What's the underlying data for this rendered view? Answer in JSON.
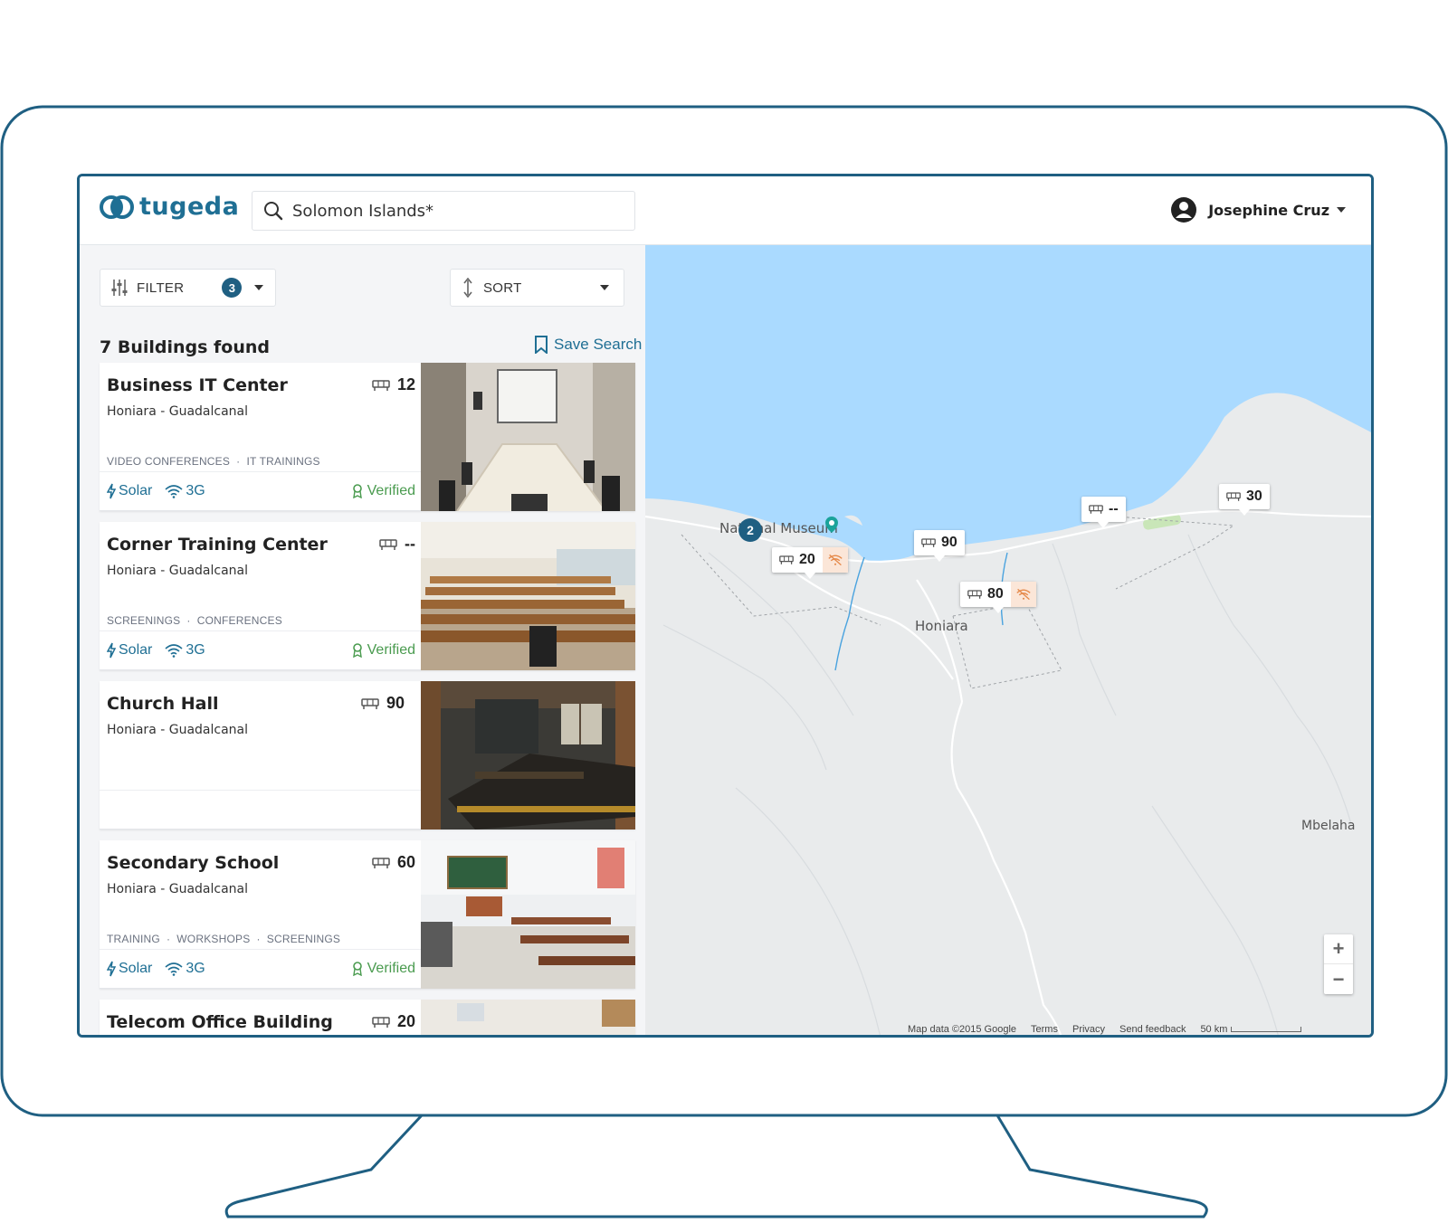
{
  "app": {
    "name": "tugeda"
  },
  "search": {
    "value": "Solomon Islands*"
  },
  "user": {
    "name": "Josephine Cruz"
  },
  "filter": {
    "label": "FILTER",
    "count": "3"
  },
  "sort": {
    "label": "SORT"
  },
  "results": {
    "count_label": "7 Buildings found",
    "save_label": "Save Search"
  },
  "buildings": [
    {
      "title": "Business IT Center",
      "location": "Honiara - Guadalcanal",
      "capacity": "12",
      "tags": [
        "VIDEO CONFERENCES",
        "IT TRAININGS"
      ],
      "amenities": [
        "Solar",
        "3G"
      ],
      "status": "Verified"
    },
    {
      "title": "Corner Training Center",
      "location": "Honiara - Guadalcanal",
      "capacity": "--",
      "tags": [
        "SCREENINGS",
        "CONFERENCES"
      ],
      "amenities": [
        "Solar",
        "3G"
      ],
      "status": "Verified"
    },
    {
      "title": "Church Hall",
      "location": "Honiara - Guadalcanal",
      "capacity": "90",
      "tags": [],
      "amenities": [],
      "status": ""
    },
    {
      "title": "Secondary School",
      "location": "Honiara - Guadalcanal",
      "capacity": "60",
      "tags": [
        "TRAINING",
        "WORKSHOPS",
        "SCREENINGS"
      ],
      "amenities": [
        "Solar",
        "3G"
      ],
      "status": "Verified"
    },
    {
      "title": "Telecom Office Building",
      "location": "",
      "capacity": "20",
      "tags": [],
      "amenities": [],
      "status": ""
    }
  ],
  "map": {
    "pins": [
      "20",
      "90",
      "80",
      "--",
      "30"
    ],
    "cluster": "2",
    "labels": {
      "museum": "National Museum",
      "city": "Honiara",
      "town": "Mbelaha"
    },
    "zoom": {
      "in": "+",
      "out": "−"
    },
    "attribution": [
      "Map data ©2015 Google",
      "Terms",
      "Privacy",
      "Send feedback",
      "50 km"
    ]
  },
  "colors": {
    "brand": "#1f5f82",
    "link": "#1f6f94",
    "verified": "#4a9b4f",
    "water": "#aadaff",
    "land": "#e9ebec"
  }
}
